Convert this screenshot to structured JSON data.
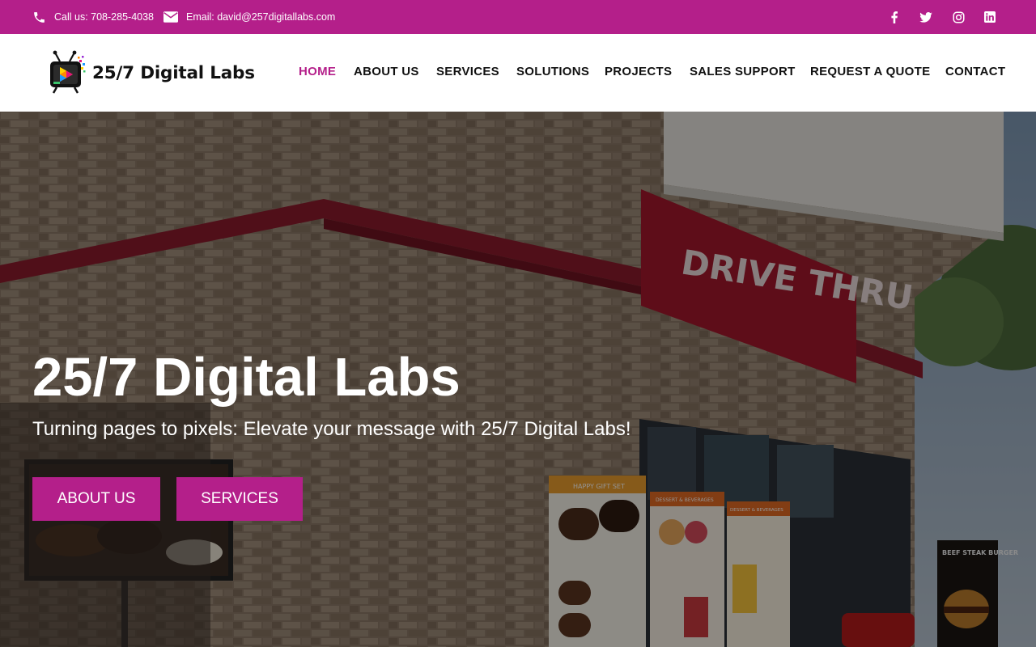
{
  "topbar": {
    "phone": "Call us: 708-285-4038",
    "email": "Email: david@257digitallabs.com",
    "social": [
      "facebook-icon",
      "twitter-icon",
      "instagram-icon",
      "linkedin-icon"
    ]
  },
  "header": {
    "logo_text": "25/7 Digital Labs",
    "nav": [
      {
        "label": "HOME",
        "active": true
      },
      {
        "label": "ABOUT US"
      },
      {
        "label": "SERVICES"
      },
      {
        "label": "SOLUTIONS"
      },
      {
        "label": "PROJECTS"
      },
      {
        "label": "SALES SUPPORT"
      },
      {
        "label": "REQUEST A QUOTE"
      },
      {
        "label": "CONTACT"
      }
    ]
  },
  "hero": {
    "title": "25/7 Digital Labs",
    "subtitle": "Turning pages to pixels: Elevate your message with 25/7 Digital Labs!",
    "buttons": [
      "ABOUT US",
      "SERVICES"
    ],
    "sign_text": "DRIVE THRU",
    "board_heading_1": "HAPPY GIFT SET",
    "board_heading_2": "DESSERT & BEVERAGES",
    "board_heading_3": "DESSERT & BEVERAGES",
    "board_side_text": "BEEF STEAK BURGER"
  },
  "colors": {
    "brand": "#b41f8a",
    "nav_text": "#111111",
    "white": "#ffffff"
  }
}
